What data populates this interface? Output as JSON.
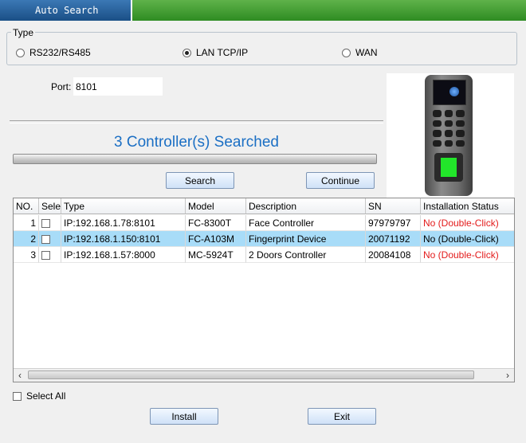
{
  "window": {
    "title": "Auto Search"
  },
  "type_group": {
    "legend": "Type",
    "options": [
      {
        "label": "RS232/RS485",
        "selected": false
      },
      {
        "label": "LAN TCP/IP",
        "selected": true
      },
      {
        "label": "WAN",
        "selected": false
      }
    ]
  },
  "port": {
    "label": "Port:",
    "value": "8101"
  },
  "search_status": "3 Controller(s) Searched",
  "buttons": {
    "search": "Search",
    "continue": "Continue",
    "install": "Install",
    "exit": "Exit"
  },
  "table": {
    "columns": [
      "NO.",
      "Sele",
      "Type",
      "Model",
      "Description",
      "SN",
      "Installation Status"
    ],
    "rows": [
      {
        "no": "1",
        "type": "IP:192.168.1.78:8101",
        "model": "FC-8300T",
        "description": "Face Controller",
        "sn": "97979797",
        "status": "No (Double-Click)",
        "selected": false
      },
      {
        "no": "2",
        "type": "IP:192.168.1.150:8101",
        "model": "FC-A103M",
        "description": "Fingerprint Device",
        "sn": "20071192",
        "status": "No (Double-Click)",
        "selected": true
      },
      {
        "no": "3",
        "type": "IP:192.168.1.57:8000",
        "model": "MC-5924T",
        "description": "2 Doors Controller",
        "sn": "20084108",
        "status": "No (Double-Click)",
        "selected": false
      }
    ]
  },
  "select_all": "Select All",
  "colors": {
    "title_tab": "#2f67a3",
    "title_bar": "#3f9d30",
    "status_text": "#e31b1b",
    "searched_text": "#1b6fc4",
    "selected_row": "#a8dcf8"
  },
  "icons": {
    "device_image": "fingerprint-terminal-image",
    "scroll_left": "chevron-left-icon",
    "scroll_right": "chevron-right-icon"
  }
}
